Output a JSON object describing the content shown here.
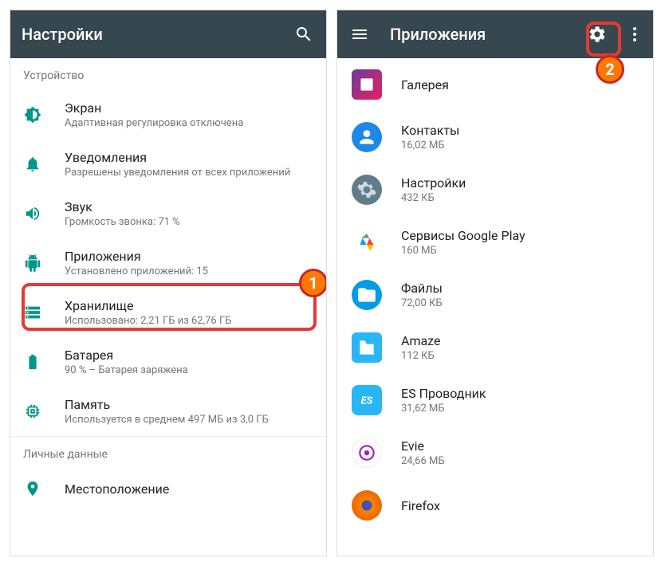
{
  "left": {
    "title": "Настройки",
    "section1": "Устройство",
    "items": [
      {
        "title": "Экран",
        "sub": "Адаптивная регулировка отключена"
      },
      {
        "title": "Уведомления",
        "sub": "Разрешены уведомления от всех приложений"
      },
      {
        "title": "Звук",
        "sub": "Громкость звонка: 71 %"
      },
      {
        "title": "Приложения",
        "sub": "Установлено приложений: 15"
      },
      {
        "title": "Хранилище",
        "sub": "Использовано: 2,21 ГБ из 62,76 ГБ"
      },
      {
        "title": "Батарея",
        "sub": "90 % – Батарея заряжена"
      },
      {
        "title": "Память",
        "sub": "Используется в среднем 497 МБ из 3,0 ГБ"
      }
    ],
    "section2": "Личные данные",
    "items2": [
      {
        "title": "Местоположение",
        "sub": ""
      }
    ]
  },
  "right": {
    "title": "Приложения",
    "apps": [
      {
        "title": "Галерея",
        "sub": ""
      },
      {
        "title": "Контакты",
        "sub": "16,02 МБ"
      },
      {
        "title": "Настройки",
        "sub": "432 КБ"
      },
      {
        "title": "Сервисы Google Play",
        "sub": "160 МБ"
      },
      {
        "title": "Файлы",
        "sub": "72,00 КБ"
      },
      {
        "title": "Amaze",
        "sub": "112 КБ"
      },
      {
        "title": "ES Проводник",
        "sub": "31,62 МБ"
      },
      {
        "title": "Evie",
        "sub": "24,66 МБ"
      },
      {
        "title": "Firefox",
        "sub": ""
      }
    ]
  },
  "badges": {
    "one": "1",
    "two": "2"
  }
}
